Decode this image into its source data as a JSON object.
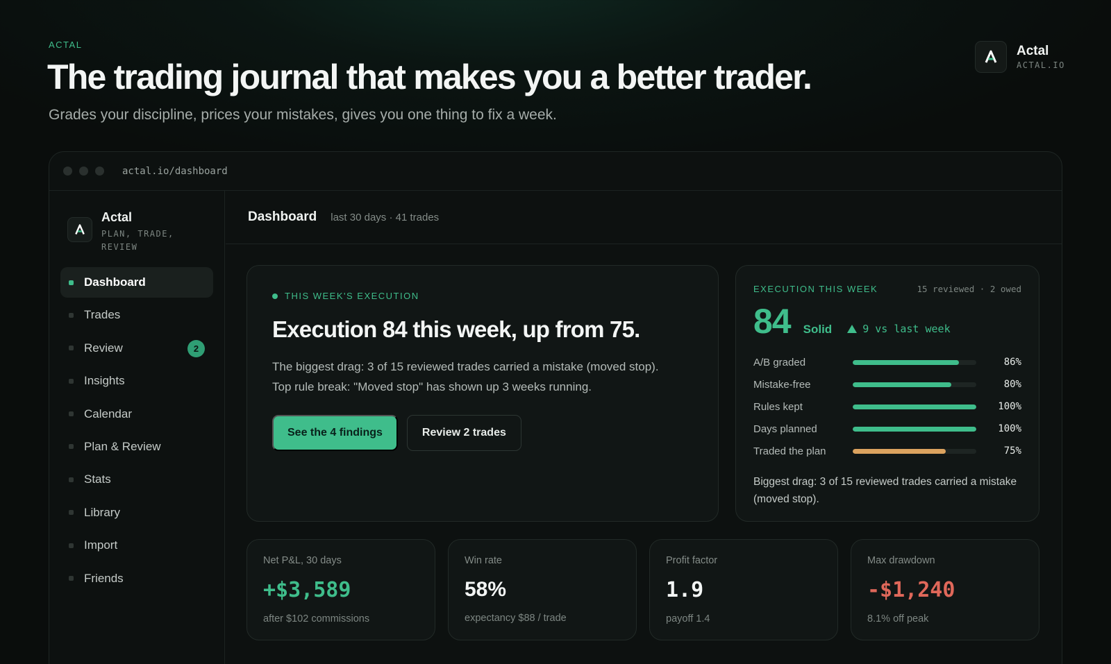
{
  "hero": {
    "eyebrow": "ACTAL",
    "headline": "The trading journal that makes you a better trader.",
    "subline": "Grades your discipline, prices your mistakes, gives you one thing to fix a week."
  },
  "brand": {
    "name": "Actal",
    "domain": "ACTAL.IO",
    "logo_icon": "A"
  },
  "browser": {
    "url": "actal.io/dashboard"
  },
  "sidebar": {
    "brand_name": "Actal",
    "tagline": "PLAN, TRADE, REVIEW",
    "items": [
      {
        "label": "Dashboard",
        "active": true
      },
      {
        "label": "Trades"
      },
      {
        "label": "Review",
        "badge": "2"
      },
      {
        "label": "Insights"
      },
      {
        "label": "Calendar"
      },
      {
        "label": "Plan & Review"
      },
      {
        "label": "Stats"
      },
      {
        "label": "Library"
      },
      {
        "label": "Import"
      },
      {
        "label": "Friends"
      }
    ]
  },
  "header": {
    "title": "Dashboard",
    "meta": "last 30 days · 41 trades"
  },
  "execution": {
    "eyebrow": "THIS WEEK'S EXECUTION",
    "title": "Execution 84 this week, up from 75.",
    "body_1": "The biggest drag: 3 of 15 reviewed trades carried a mistake (moved stop).",
    "body_2": "Top rule break: \"Moved stop\" has shown up 3 weeks running.",
    "primary_label": "See the 4 findings",
    "secondary_label": "Review 2 trades"
  },
  "scorecard": {
    "eyebrow": "EXECUTION THIS WEEK",
    "meta": "15 reviewed · 2 owed",
    "score": "84",
    "grade": "Solid",
    "delta": "9 vs last week",
    "metrics": [
      {
        "label": "A/B graded",
        "value": "86%",
        "fraction": 0.86,
        "color": "#3fbd8b"
      },
      {
        "label": "Mistake-free",
        "value": "80%",
        "fraction": 0.8,
        "color": "#3fbd8b"
      },
      {
        "label": "Rules kept",
        "value": "100%",
        "fraction": 1.0,
        "color": "#3fbd8b"
      },
      {
        "label": "Days planned",
        "value": "100%",
        "fraction": 1.0,
        "color": "#3fbd8b"
      },
      {
        "label": "Traded the plan",
        "value": "75%",
        "fraction": 0.75,
        "color": "#dca35f"
      }
    ],
    "footnote": "Biggest drag: 3 of 15 reviewed trades carried a mistake (moved stop)."
  },
  "stats": [
    {
      "label": "Net P&L, 30 days",
      "value": "+$3,589",
      "note": "after $102 commissions",
      "color": "#3fbd8b",
      "mono": true
    },
    {
      "label": "Win rate",
      "value": "58%",
      "note": "expectancy $88 / trade",
      "color": "#f3f5f4",
      "mono": false
    },
    {
      "label": "Profit factor",
      "value": "1.9",
      "note": "payoff 1.4",
      "color": "#f3f5f4",
      "mono": true
    },
    {
      "label": "Max drawdown",
      "value": "-$1,240",
      "note": "8.1% off peak",
      "color": "#e0685a",
      "mono": true
    }
  ]
}
